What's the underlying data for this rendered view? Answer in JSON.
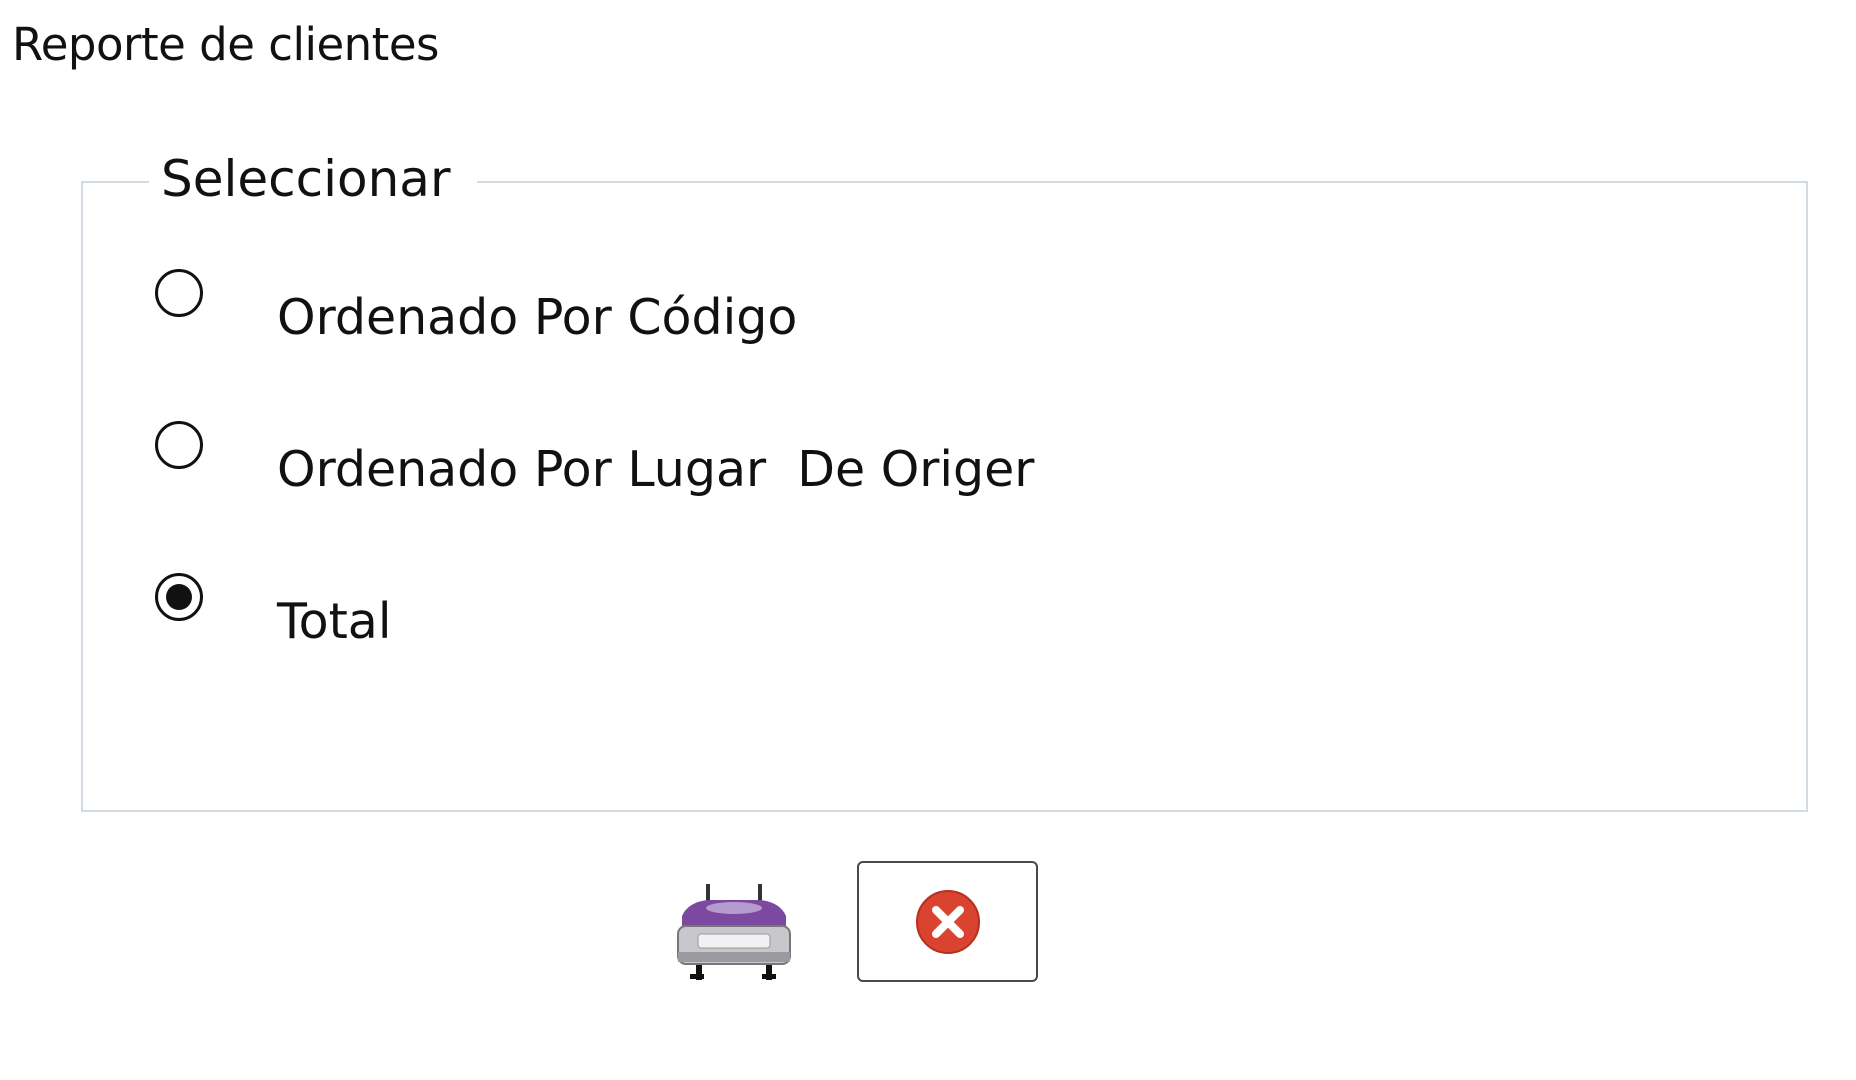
{
  "window": {
    "title": "Reporte de clientes"
  },
  "group": {
    "legend": "Seleccionar",
    "options": [
      {
        "label": "Ordenado Por Código",
        "checked": false
      },
      {
        "label": "Ordenado Por Lugar  De Origer",
        "checked": false
      },
      {
        "label": "Total",
        "checked": true
      }
    ]
  },
  "actions": {
    "print_icon": "printer-icon",
    "close_icon": "close-circle-icon"
  },
  "colors": {
    "printer_accent": "#7b4aa0",
    "close_red": "#d9432f",
    "border": "#d2dae3"
  }
}
